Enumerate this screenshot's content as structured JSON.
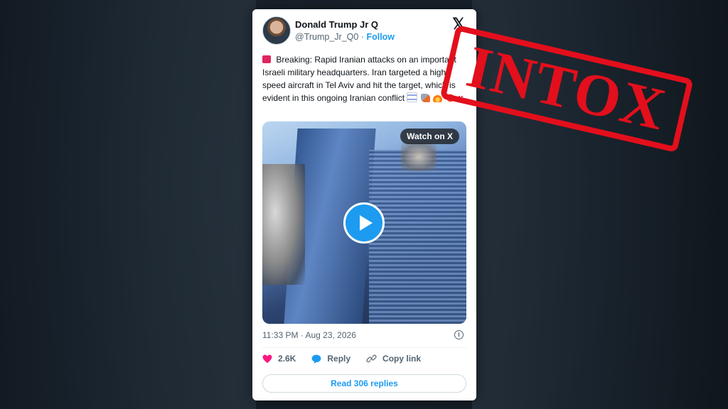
{
  "tweet": {
    "author_name": "Donald Trump Jr Q",
    "handle": "@Trump_Jr_Q0",
    "separator": " · ",
    "follow_label": "Follow",
    "text": "Breaking: Rapid Iranian attacks on an important Israeli military headquarters. Iran targeted a high-speed aircraft in Tel Aviv and hit the target, which is evident in this ongoing Iranian conflict",
    "emojis": [
      "israel-flag",
      "rocket",
      "fire",
      "collision"
    ],
    "exclamation": "‼",
    "media": {
      "watch_label": "Watch on X",
      "play_icon": "play-icon"
    },
    "timestamp": "11:33 PM · Aug 23, 2026",
    "likes": "2.6K",
    "reply_label": "Reply",
    "copy_link_label": "Copy link",
    "read_replies_label": "Read 306 replies"
  },
  "stamp": {
    "text": "INTOX",
    "color": "#e30f1c"
  },
  "colors": {
    "accent": "#1d9bf0",
    "like": "#f91880",
    "text": "#0f1419",
    "muted": "#536471"
  }
}
